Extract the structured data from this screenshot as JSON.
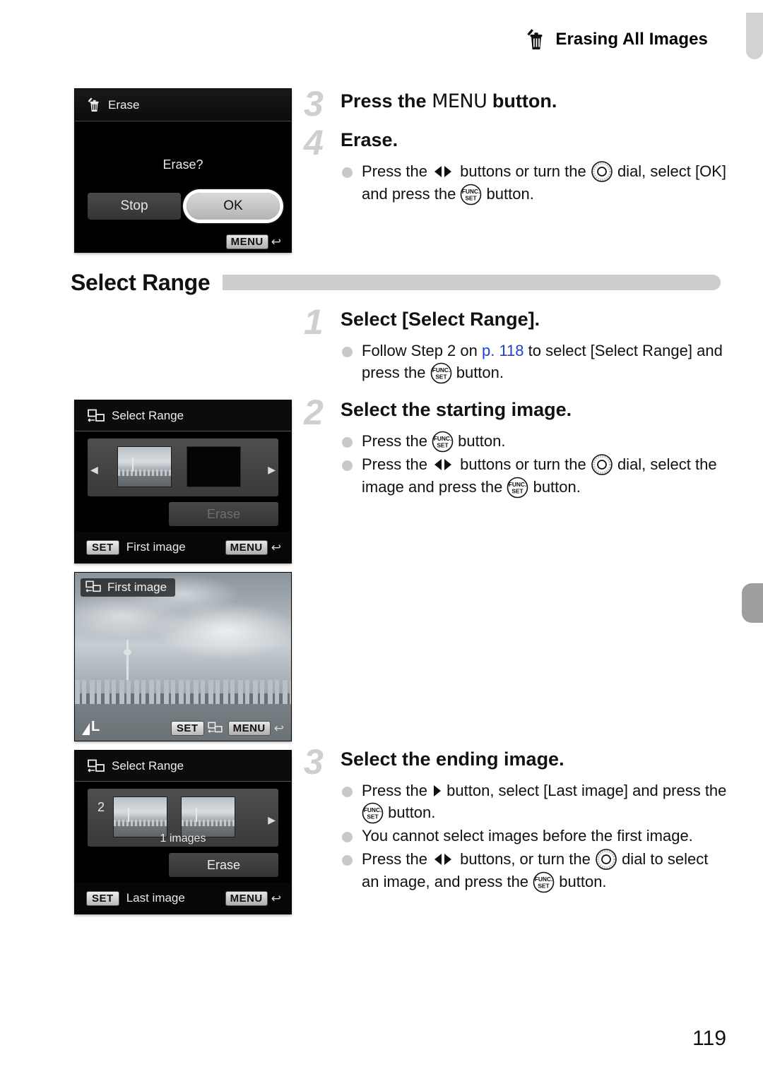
{
  "header": {
    "title": "Erasing All Images",
    "icon": "trash-erase-icon"
  },
  "page_number": "119",
  "section": {
    "title": "Select Range"
  },
  "steps": [
    {
      "number": "3",
      "title_before": "Press the ",
      "title_icon": "MENU",
      "title_after": " button.",
      "bullets": []
    },
    {
      "number": "4",
      "title": "Erase.",
      "bullets": [
        {
          "parts": [
            {
              "t": "text",
              "v": "Press the "
            },
            {
              "t": "icon",
              "v": "left-right-buttons-icon"
            },
            {
              "t": "text",
              "v": " buttons or turn the "
            },
            {
              "t": "icon",
              "v": "control-dial-icon"
            },
            {
              "t": "text",
              "v": " dial, select [OK] and press the "
            },
            {
              "t": "icon",
              "v": "func-set-button-icon"
            },
            {
              "t": "text",
              "v": " button."
            }
          ]
        }
      ]
    },
    {
      "number": "1",
      "title": "Select [Select Range].",
      "bullets": [
        {
          "parts": [
            {
              "t": "text",
              "v": "Follow Step 2 on "
            },
            {
              "t": "link",
              "v": "p. 118"
            },
            {
              "t": "text",
              "v": " to select [Select Range] and press the "
            },
            {
              "t": "icon",
              "v": "func-set-button-icon"
            },
            {
              "t": "text",
              "v": " button."
            }
          ]
        }
      ]
    },
    {
      "number": "2",
      "title": "Select the starting image.",
      "bullets": [
        {
          "parts": [
            {
              "t": "text",
              "v": "Press the "
            },
            {
              "t": "icon",
              "v": "func-set-button-icon"
            },
            {
              "t": "text",
              "v": " button."
            }
          ]
        },
        {
          "parts": [
            {
              "t": "text",
              "v": "Press the "
            },
            {
              "t": "icon",
              "v": "left-right-buttons-icon"
            },
            {
              "t": "text",
              "v": " buttons or turn the "
            },
            {
              "t": "icon",
              "v": "control-dial-icon"
            },
            {
              "t": "text",
              "v": " dial, select the image and press the "
            },
            {
              "t": "icon",
              "v": "func-set-button-icon"
            },
            {
              "t": "text",
              "v": " button."
            }
          ]
        }
      ]
    },
    {
      "number": "3",
      "title": "Select the ending image.",
      "bullets": [
        {
          "parts": [
            {
              "t": "text",
              "v": "Press the "
            },
            {
              "t": "icon",
              "v": "right-button-icon"
            },
            {
              "t": "text",
              "v": " button, select [Last image] and press the "
            },
            {
              "t": "icon",
              "v": "func-set-button-icon"
            },
            {
              "t": "text",
              "v": " button."
            }
          ]
        },
        {
          "parts": [
            {
              "t": "text",
              "v": "You cannot select images before the first image."
            }
          ]
        },
        {
          "parts": [
            {
              "t": "text",
              "v": "Press the "
            },
            {
              "t": "icon",
              "v": "left-right-buttons-icon"
            },
            {
              "t": "text",
              "v": " buttons, or turn the "
            },
            {
              "t": "icon",
              "v": "control-dial-icon"
            },
            {
              "t": "text",
              "v": " dial to select an image, and press the "
            },
            {
              "t": "icon",
              "v": "func-set-button-icon"
            },
            {
              "t": "text",
              "v": " button."
            }
          ]
        }
      ]
    }
  ],
  "screens": {
    "erase_confirm": {
      "title": "Erase",
      "prompt": "Erase?",
      "button_stop": "Stop",
      "button_ok": "OK",
      "selected_button": "OK",
      "footer_menu": "MENU"
    },
    "select_range_empty": {
      "title": "Select Range",
      "erase_label": "Erase",
      "erase_enabled": false,
      "footer_set": "SET",
      "footer_label": "First image",
      "footer_menu": "MENU"
    },
    "first_image": {
      "tag": "First image",
      "quality": "L",
      "footer_set": "SET",
      "footer_menu": "MENU"
    },
    "select_range_filled": {
      "title": "Select Range",
      "index": "2",
      "count": "1 images",
      "erase_label": "Erase",
      "erase_enabled": true,
      "footer_set": "SET",
      "footer_label": "Last image",
      "footer_menu": "MENU"
    }
  },
  "colors": {
    "link": "#1f3fd6",
    "step_number": "#cfcfcf",
    "section_bar": "#cdcdcd",
    "tab_top": "#d2d2d2",
    "tab_side": "#9e9e9e"
  }
}
